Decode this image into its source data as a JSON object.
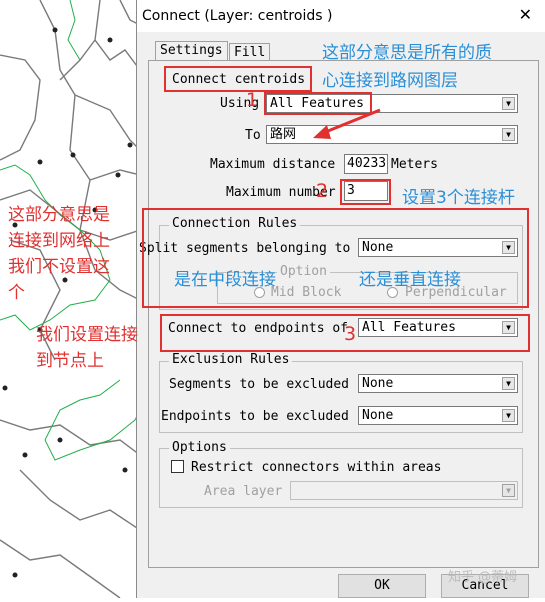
{
  "colors": {
    "annotation_red": "#e03030",
    "annotation_blue": "#2a8fd6",
    "map_green": "#22b04a",
    "map_gray": "#7a7a7a"
  },
  "dialog": {
    "title": "Connect (Layer: centroids )",
    "close_label": "✕",
    "tabs": [
      "Settings",
      "Fill"
    ],
    "connect_centroids_label": "Connect centroids",
    "using_label": "Using",
    "using_value": "All Features",
    "to_label": "To",
    "to_value": "路网",
    "max_distance_label": "Maximum distance",
    "max_distance_value": "40233",
    "max_distance_unit": "Meters",
    "max_number_label": "Maximum number",
    "max_number_value": "3",
    "connection_rules": {
      "title": "Connection Rules",
      "split_label": "Split segments belonging to",
      "split_value": "None",
      "option_group_title": "Option",
      "mid_block": "Mid Block",
      "perpendicular": "Perpendicular"
    },
    "connect_endpoints_label": "Connect to endpoints of",
    "connect_endpoints_value": "All Features",
    "exclusion": {
      "title": "Exclusion Rules",
      "segments_label": "Segments to be excluded",
      "segments_value": "None",
      "endpoints_label": "Endpoints to be excluded",
      "endpoints_value": "None"
    },
    "options": {
      "title": "Options",
      "restrict_label": "Restrict connectors within areas",
      "area_layer_label": "Area layer",
      "area_layer_value": ""
    },
    "ok_label": "OK",
    "cancel_label": "Cancel"
  },
  "annotations": {
    "n1": "1",
    "n2": "2",
    "n3": "3",
    "blue_top": [
      "这部分意思是所有的质",
      "心连接到路网图层"
    ],
    "blue_max": "设置3个连接杆",
    "blue_mid": "是在中段连接",
    "blue_perp": "还是垂直连接",
    "red_left_top": [
      "这部分意思是",
      "连接到网络上",
      "我们不设置这",
      "个"
    ],
    "red_left_bottom": [
      "我们设置连接",
      "到节点上"
    ],
    "watermark": "知乎 @蒂姆"
  }
}
